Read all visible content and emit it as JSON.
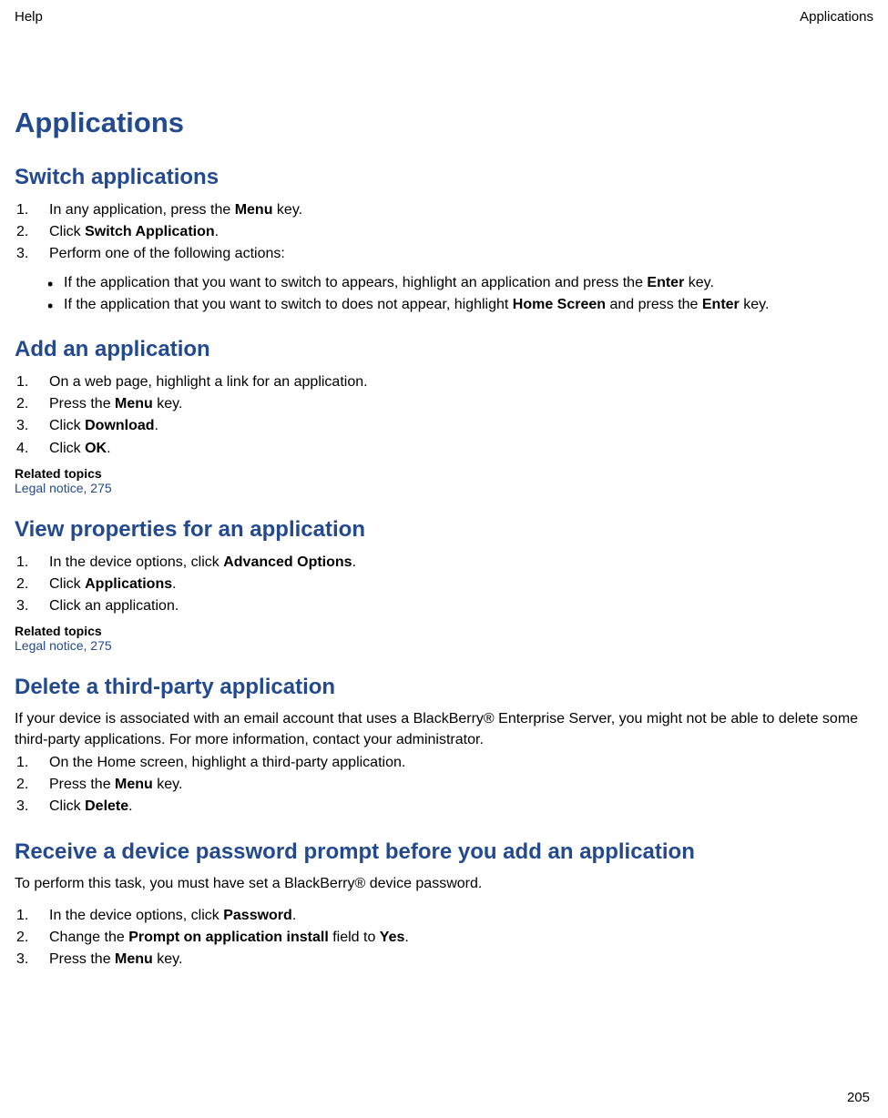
{
  "header": {
    "left": "Help",
    "right": "Applications"
  },
  "page": {
    "title": "Applications",
    "number": "205"
  },
  "sections": [
    {
      "heading": "Switch applications",
      "steps": [
        [
          {
            "t": "In any application, press the "
          },
          {
            "t": "Menu",
            "b": true
          },
          {
            "t": " key."
          }
        ],
        [
          {
            "t": "Click "
          },
          {
            "t": "Switch Application",
            "b": true
          },
          {
            "t": "."
          }
        ],
        [
          {
            "t": "Perform one of the following actions:"
          }
        ]
      ],
      "bullets": [
        [
          {
            "t": "If the application that you want to switch to appears, highlight an application and press the "
          },
          {
            "t": "Enter",
            "b": true
          },
          {
            "t": " key."
          }
        ],
        [
          {
            "t": "If the application that you want to switch to does not appear, highlight "
          },
          {
            "t": "Home Screen",
            "b": true
          },
          {
            "t": " and press the "
          },
          {
            "t": "Enter",
            "b": true
          },
          {
            "t": " key."
          }
        ]
      ]
    },
    {
      "heading": "Add an application",
      "steps": [
        [
          {
            "t": "On a web page, highlight a link for an application."
          }
        ],
        [
          {
            "t": "Press the "
          },
          {
            "t": "Menu",
            "b": true
          },
          {
            "t": " key."
          }
        ],
        [
          {
            "t": "Click "
          },
          {
            "t": "Download",
            "b": true
          },
          {
            "t": "."
          }
        ],
        [
          {
            "t": "Click "
          },
          {
            "t": "OK",
            "b": true
          },
          {
            "t": "."
          }
        ]
      ],
      "related": {
        "label": "Related topics",
        "link": "Legal notice, 275"
      }
    },
    {
      "heading": "View properties for an application",
      "steps": [
        [
          {
            "t": "In the device options, click "
          },
          {
            "t": "Advanced Options",
            "b": true
          },
          {
            "t": "."
          }
        ],
        [
          {
            "t": "Click "
          },
          {
            "t": "Applications",
            "b": true
          },
          {
            "t": "."
          }
        ],
        [
          {
            "t": "Click an application."
          }
        ]
      ],
      "related": {
        "label": "Related topics",
        "link": "Legal notice, 275"
      }
    },
    {
      "heading": "Delete a third-party application",
      "intro": "If your device is associated with an email account that uses a BlackBerry® Enterprise Server, you might not be able to delete some third-party applications. For more information, contact your administrator.",
      "steps": [
        [
          {
            "t": "On the Home screen, highlight a third-party application."
          }
        ],
        [
          {
            "t": "Press the "
          },
          {
            "t": "Menu",
            "b": true
          },
          {
            "t": " key."
          }
        ],
        [
          {
            "t": "Click "
          },
          {
            "t": "Delete",
            "b": true
          },
          {
            "t": "."
          }
        ]
      ]
    },
    {
      "heading": "Receive a device password prompt before you add an application",
      "intro": "To perform this task, you must have set a BlackBerry® device password.",
      "introGap": true,
      "steps": [
        [
          {
            "t": "In the device options, click "
          },
          {
            "t": "Password",
            "b": true
          },
          {
            "t": "."
          }
        ],
        [
          {
            "t": "Change the "
          },
          {
            "t": "Prompt on application install",
            "b": true
          },
          {
            "t": " field to "
          },
          {
            "t": "Yes",
            "b": true
          },
          {
            "t": "."
          }
        ],
        [
          {
            "t": "Press the "
          },
          {
            "t": "Menu",
            "b": true
          },
          {
            "t": " key."
          }
        ]
      ]
    }
  ]
}
